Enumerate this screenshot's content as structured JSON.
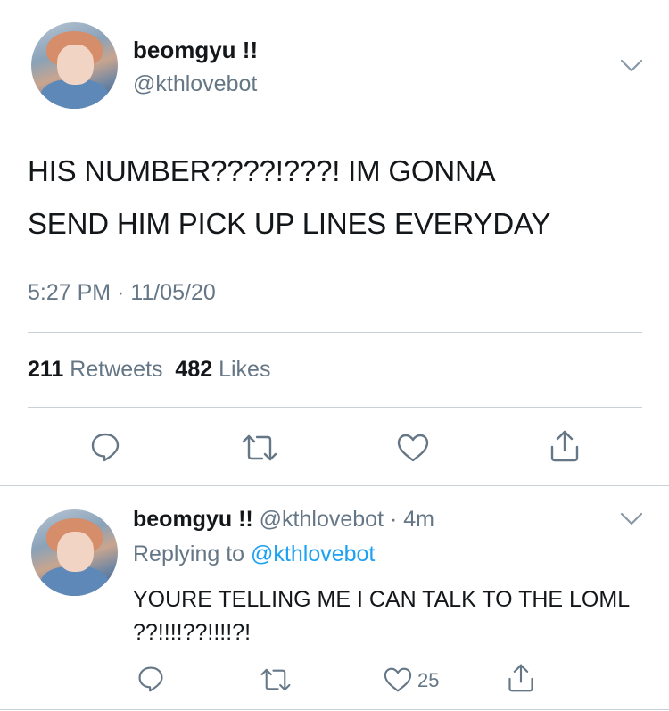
{
  "tweet": {
    "display_name": "beomgyu !!",
    "handle": "@kthlovebot",
    "text_line1": "HIS NUMBER????!???! IM GONNA",
    "text_line2": "SEND HIM PICK UP LINES EVERYDAY",
    "timestamp": "5:27 PM · 11/05/20",
    "retweet_count": "211",
    "retweet_label": "Retweets",
    "like_count": "482",
    "like_label": "Likes"
  },
  "reply": {
    "display_name": "beomgyu !!",
    "handle_and_time": "@kthlovebot · 4m",
    "replying_prefix": "Replying to",
    "replying_handle": "@kthlovebot",
    "text": "YOURE TELLING ME I CAN TALK TO THE LOML ??!!!!??!!!!?!",
    "like_count": "25"
  },
  "icons": {
    "reply": "speech-bubble-icon",
    "retweet": "retweet-icon",
    "like": "heart-icon",
    "share": "share-icon",
    "menu": "chevron-down-icon"
  },
  "colors": {
    "text": "#14171a",
    "secondary": "#657786",
    "link": "#1da1f2",
    "divider": "#c9d1d8"
  }
}
